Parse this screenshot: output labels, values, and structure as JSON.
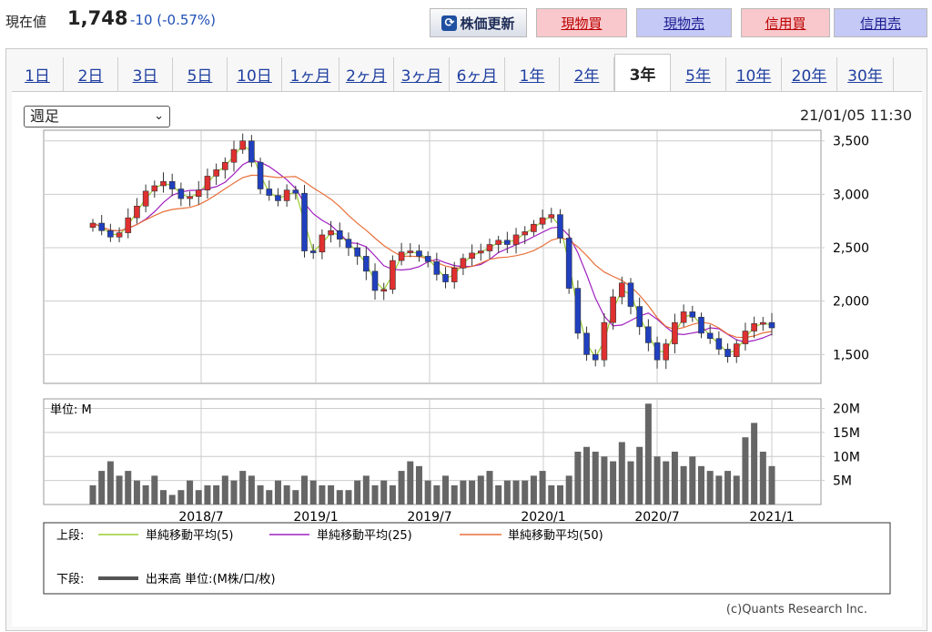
{
  "header": {
    "price_label": "現在値",
    "price": "1,748",
    "change": "-10 (-0.57%)",
    "buttons": [
      "株価更新",
      "現物買",
      "現物売",
      "信用買",
      "信用売"
    ]
  },
  "tabs": [
    "1日",
    "2日",
    "3日",
    "5日",
    "10日",
    "1ヶ月",
    "2ヶ月",
    "3ヶ月",
    "6ヶ月",
    "1年",
    "2年",
    "3年",
    "5年",
    "10年",
    "20年",
    "30年"
  ],
  "active_tab": "3年",
  "select": {
    "value": "週足"
  },
  "timestamp": "21/01/05 11:30",
  "volume_unit_label": "単位: M",
  "legend": {
    "upper_label": "上段:",
    "lower_label": "下段:",
    "items": [
      {
        "name": "単純移動平均(5)",
        "color": "#9acd32"
      },
      {
        "name": "単純移動平均(25)",
        "color": "#a020c0"
      },
      {
        "name": "単純移動平均(50)",
        "color": "#e8703a"
      }
    ],
    "volume": "出来高 単位:(M株/口/枚)"
  },
  "credit": "(c)Quants Research Inc.",
  "chart_data": {
    "type": "candlestick",
    "x_ticks": [
      "2018/7",
      "2019/1",
      "2019/7",
      "2020/1",
      "2020/7",
      "2021/1"
    ],
    "price_ticks": [
      3500,
      3000,
      2500,
      2000,
      1500
    ],
    "price_range": [
      1230,
      3600
    ],
    "volume_ticks": [
      "20M",
      "15M",
      "10M",
      "5M"
    ],
    "volume_range": [
      0,
      22
    ],
    "x_range": [
      0,
      1
    ],
    "close": [
      2730,
      2660,
      2600,
      2640,
      2780,
      2890,
      3030,
      3080,
      3120,
      3050,
      2960,
      2980,
      3040,
      3170,
      3230,
      3300,
      3420,
      3500,
      3300,
      3050,
      2990,
      2940,
      3040,
      3010,
      2470,
      2460,
      2620,
      2660,
      2580,
      2500,
      2420,
      2280,
      2100,
      2110,
      2380,
      2460,
      2470,
      2420,
      2370,
      2250,
      2180,
      2310,
      2400,
      2450,
      2470,
      2530,
      2570,
      2530,
      2620,
      2650,
      2720,
      2780,
      2810,
      2590,
      2120,
      1700,
      1500,
      1450,
      1800,
      2040,
      2170,
      1950,
      1760,
      1610,
      1450,
      1600,
      1800,
      1900,
      1850,
      1700,
      1650,
      1550,
      1480,
      1600,
      1720,
      1790,
      1800,
      1750
    ],
    "volume": [
      4,
      7,
      9,
      6,
      7,
      5,
      4,
      6,
      3,
      2,
      3,
      5,
      3,
      4,
      4,
      6,
      5,
      7,
      6,
      4,
      3,
      5,
      4,
      3,
      6,
      5,
      4,
      4,
      3,
      3,
      5,
      6,
      4,
      5,
      4,
      7,
      9,
      8,
      5,
      4,
      6,
      4,
      5,
      5,
      6,
      7,
      4,
      5,
      5,
      5,
      6,
      7,
      4,
      4,
      6,
      11,
      12,
      11,
      10,
      9,
      13,
      9,
      12,
      21,
      10,
      9,
      11,
      8,
      10,
      8,
      7,
      6,
      7,
      6,
      14,
      17,
      11,
      8
    ]
  }
}
